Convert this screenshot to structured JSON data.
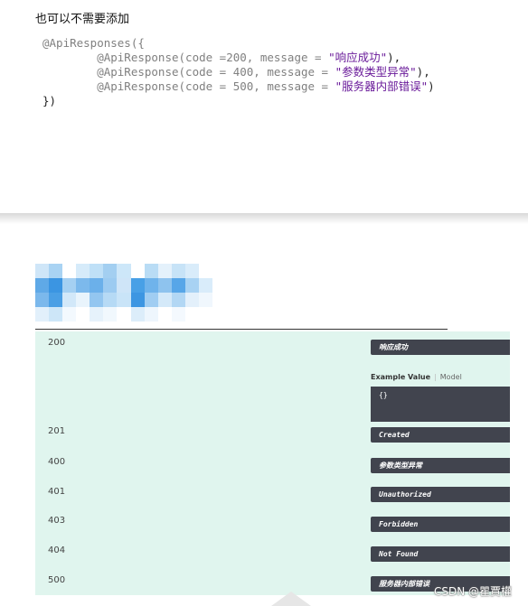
{
  "note": "也可以不需要添加",
  "code": {
    "line1": "@ApiResponses({",
    "responses": [
      {
        "prefix": "        @ApiResponse(code =200, message = ",
        "msg": "\"响应成功\"",
        "suffix": "),"
      },
      {
        "prefix": "        @ApiResponse(code = 400, message = ",
        "msg": "\"参数类型异常\"",
        "suffix": "),"
      },
      {
        "prefix": "        @ApiResponse(code = 500, message = ",
        "msg": "\"服务器内部错误\"",
        "suffix": ")"
      }
    ],
    "line_end": "})"
  },
  "panel": {
    "rows": [
      {
        "code": "200",
        "message": "响应成功"
      },
      {
        "code": "201",
        "message": "Created"
      },
      {
        "code": "400",
        "message": "参数类型异常"
      },
      {
        "code": "401",
        "message": "Unauthorized"
      },
      {
        "code": "403",
        "message": "Forbidden"
      },
      {
        "code": "404",
        "message": "Not Found"
      },
      {
        "code": "500",
        "message": "服务器内部错误"
      }
    ],
    "example_value_label": "Example Value",
    "model_label": "Model",
    "example_json": "{}"
  },
  "watermark": "CSDN @瞿賈權",
  "colors": {
    "panel_bg": "#e0f5ee",
    "pill_bg": "#41444e",
    "string": "#6a1b9a",
    "annotation": "#808080"
  }
}
